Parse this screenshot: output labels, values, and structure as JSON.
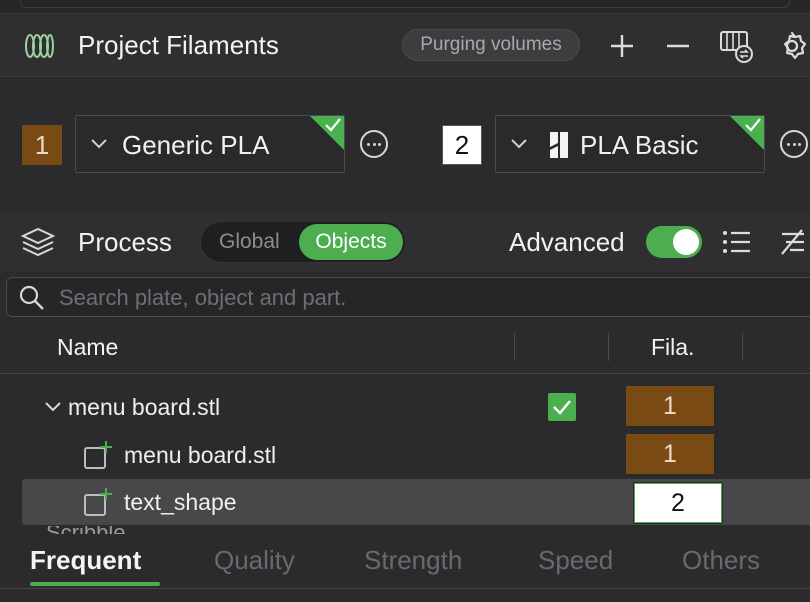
{
  "filaments_section": {
    "title": "Project Filaments",
    "purge_label": "Purging volumes",
    "icons": [
      "filaments-icon",
      "plus-icon",
      "minus-icon",
      "sync-filaments-icon",
      "gear-icon"
    ],
    "slots": [
      {
        "number": "1",
        "preset": "Generic PLA",
        "color": "#7a4a14",
        "brand_icon": null
      },
      {
        "number": "2",
        "preset": "PLA Basic",
        "color": "#ffffff",
        "brand_icon": "bambu-icon"
      }
    ]
  },
  "process_section": {
    "title": "Process",
    "scope_options": [
      "Global",
      "Objects"
    ],
    "scope_selected": "Objects",
    "advanced_label": "Advanced",
    "advanced_on": true
  },
  "search": {
    "placeholder": "Search plate, object and part."
  },
  "table": {
    "columns": {
      "name": "Name",
      "filament": "Fila."
    },
    "rows": [
      {
        "name": "menu board.stl",
        "kind": "object",
        "expanded": true,
        "checked": true,
        "filament": "1",
        "filament_color": "#7a4a14"
      },
      {
        "name": "menu board.stl",
        "kind": "part",
        "filament": "1",
        "filament_color": "#7a4a14"
      },
      {
        "name": "text_shape",
        "kind": "part",
        "selected": true,
        "filament": "2",
        "filament_color": "#ffffff"
      }
    ],
    "peek_text": "Scribble"
  },
  "tabs": {
    "items": [
      "Frequent",
      "Quality",
      "Strength",
      "Speed",
      "Others"
    ],
    "active": "Frequent"
  },
  "colors": {
    "accent": "#4cae4f",
    "background": "#2b2b2d"
  }
}
